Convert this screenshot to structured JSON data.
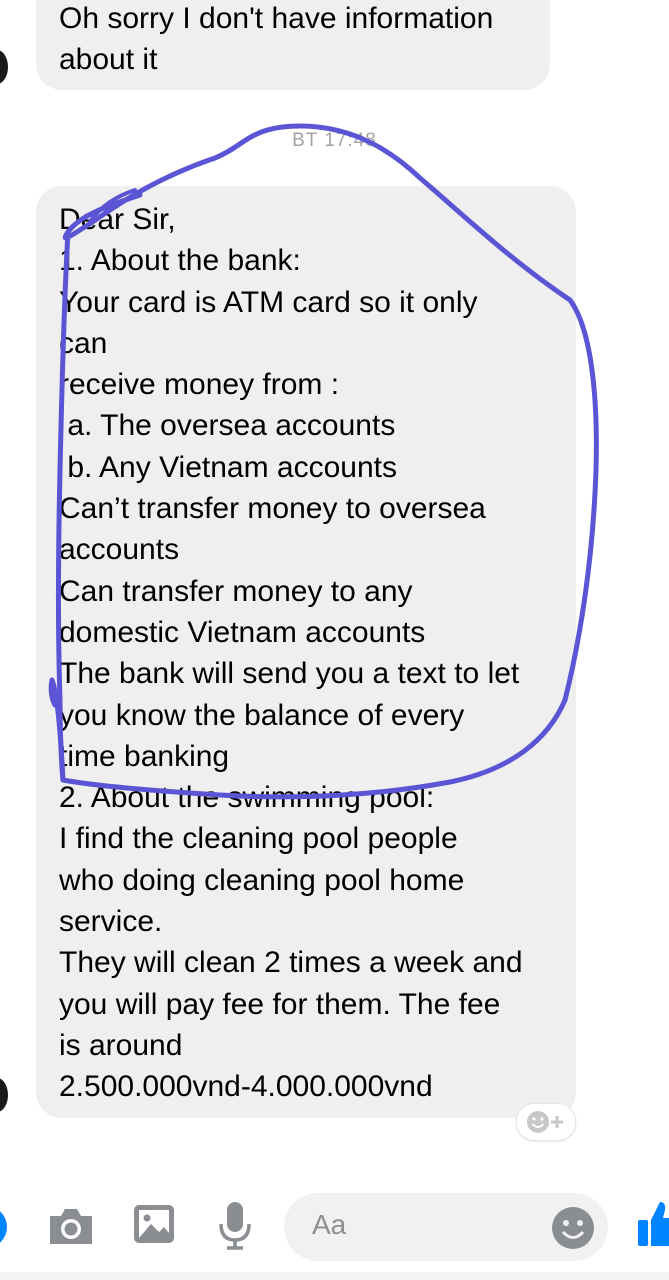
{
  "chat": {
    "prev_message_lines": [
      "Oh sorry I don't have information",
      "about it"
    ],
    "timestamp": "BT 17:48",
    "message_lines": [
      "Dear Sir,",
      "1. About the bank:",
      "Your card is ATM card so it only",
      "can",
      "receive money from :",
      " a. The oversea accounts",
      " b. Any Vietnam accounts",
      "Can’t transfer money to oversea",
      "accounts",
      "Can transfer money to any",
      "domestic Vietnam accounts",
      "The bank will send you a text to let",
      "you know the balance of every",
      "time banking",
      "2. About the swimming pool:",
      "I find the cleaning pool people",
      "who doing cleaning pool home",
      "service.",
      "They will clean 2 times a week and",
      "you will pay fee for them. The fee",
      "is around",
      "2.500.000vnd-4.000.000vnd"
    ]
  },
  "composer": {
    "placeholder": "Aa",
    "icons": [
      "camera-icon",
      "gallery-icon",
      "microphone-icon",
      "emoji-icon",
      "thumbs-up-icon"
    ]
  },
  "colors": {
    "bubble": "#efefef",
    "messenger_blue": "#0084ff",
    "annotation": "#5b55d6",
    "icon_gray": "#8a8d91"
  }
}
